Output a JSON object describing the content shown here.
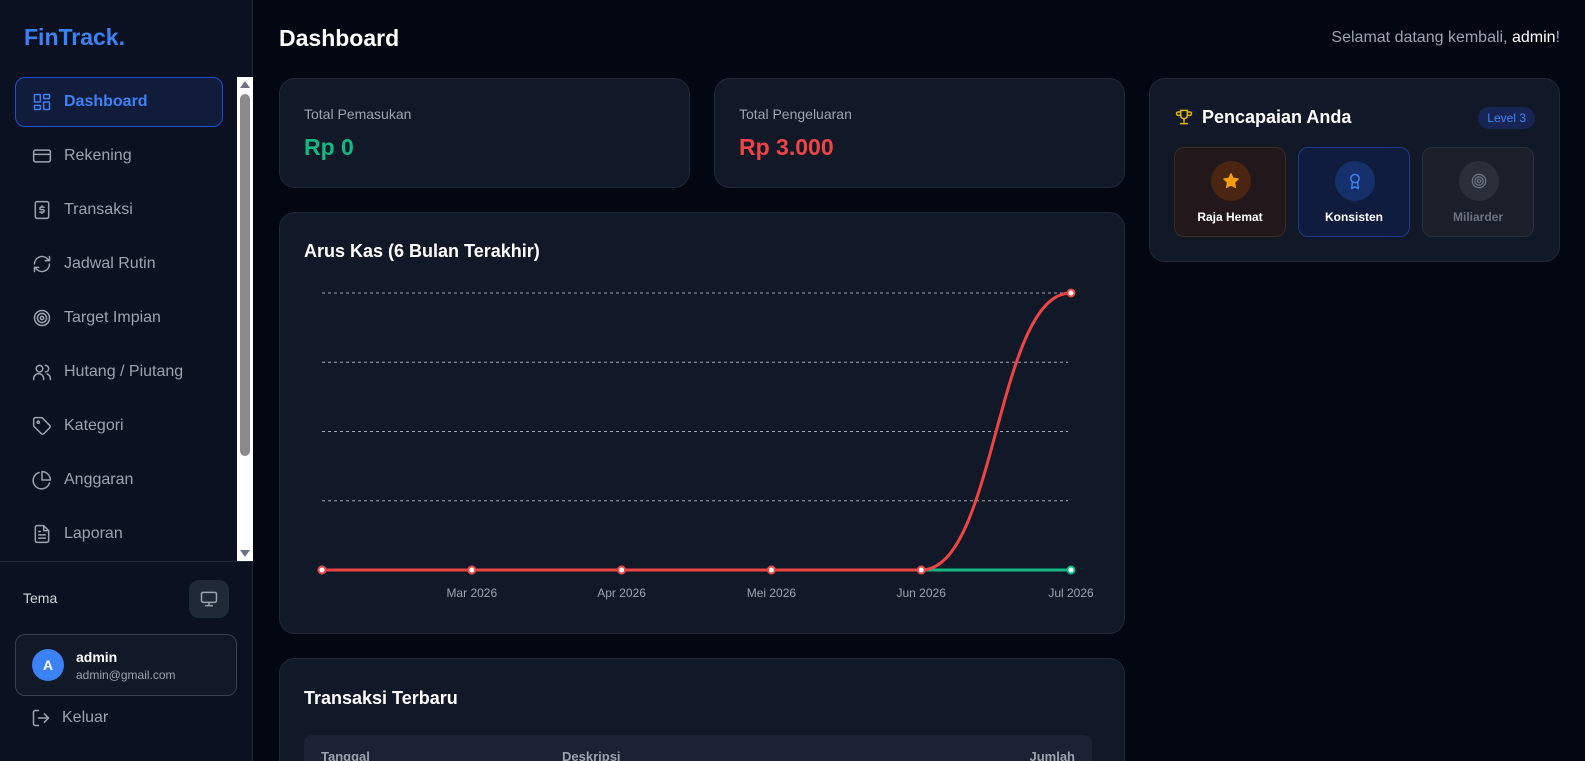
{
  "brand": "FinTrack.",
  "sidebar": {
    "items": [
      {
        "label": "Dashboard",
        "icon": "layout-dashboard-icon",
        "active": true
      },
      {
        "label": "Rekening",
        "icon": "credit-card-icon"
      },
      {
        "label": "Transaksi",
        "icon": "receipt-icon"
      },
      {
        "label": "Jadwal Rutin",
        "icon": "refresh-icon"
      },
      {
        "label": "Target Impian",
        "icon": "target-icon"
      },
      {
        "label": "Hutang / Piutang",
        "icon": "users-icon"
      },
      {
        "label": "Kategori",
        "icon": "tag-icon"
      },
      {
        "label": "Anggaran",
        "icon": "pie-chart-icon"
      },
      {
        "label": "Laporan",
        "icon": "file-text-icon"
      }
    ],
    "tema_label": "Tema",
    "user": {
      "initial": "A",
      "name": "admin",
      "email": "admin@gmail.com"
    },
    "logout_label": "Keluar"
  },
  "header": {
    "title": "Dashboard",
    "welcome_prefix": "Selamat datang kembali, ",
    "welcome_user": "admin",
    "welcome_suffix": "!"
  },
  "stats": {
    "income": {
      "label": "Total Pemasukan",
      "value": "Rp 0",
      "color": "#10b981"
    },
    "expense": {
      "label": "Total Pengeluaran",
      "value": "Rp 3.000",
      "color": "#ef4444"
    }
  },
  "achievements": {
    "title": "Pencapaian Anda",
    "level": "Level 3",
    "badges": [
      {
        "label": "Raja Hemat",
        "icon": "star-icon",
        "state": "unlocked"
      },
      {
        "label": "Konsisten",
        "icon": "award-icon",
        "state": "unlocked"
      },
      {
        "label": "Miliarder",
        "icon": "target-icon",
        "state": "locked"
      }
    ]
  },
  "chart_data": {
    "type": "line",
    "title": "Arus Kas (6 Bulan Terakhir)",
    "categories": [
      "",
      "Mar 2026",
      "Apr 2026",
      "Mei 2026",
      "Jun 2026",
      "Jul 2026"
    ],
    "series": [
      {
        "values": [
          0,
          0,
          0,
          0,
          0,
          0
        ],
        "color": "#10b981"
      },
      {
        "values": [
          0,
          0,
          0,
          0,
          0,
          3000
        ],
        "color": "#ef4444"
      }
    ],
    "ylim": [
      0,
      3000
    ],
    "grid": true,
    "grid_style": "dashed"
  },
  "transactions": {
    "title": "Transaksi Terbaru",
    "columns": [
      "Tanggal",
      "Deskripsi",
      "Jumlah"
    ]
  }
}
